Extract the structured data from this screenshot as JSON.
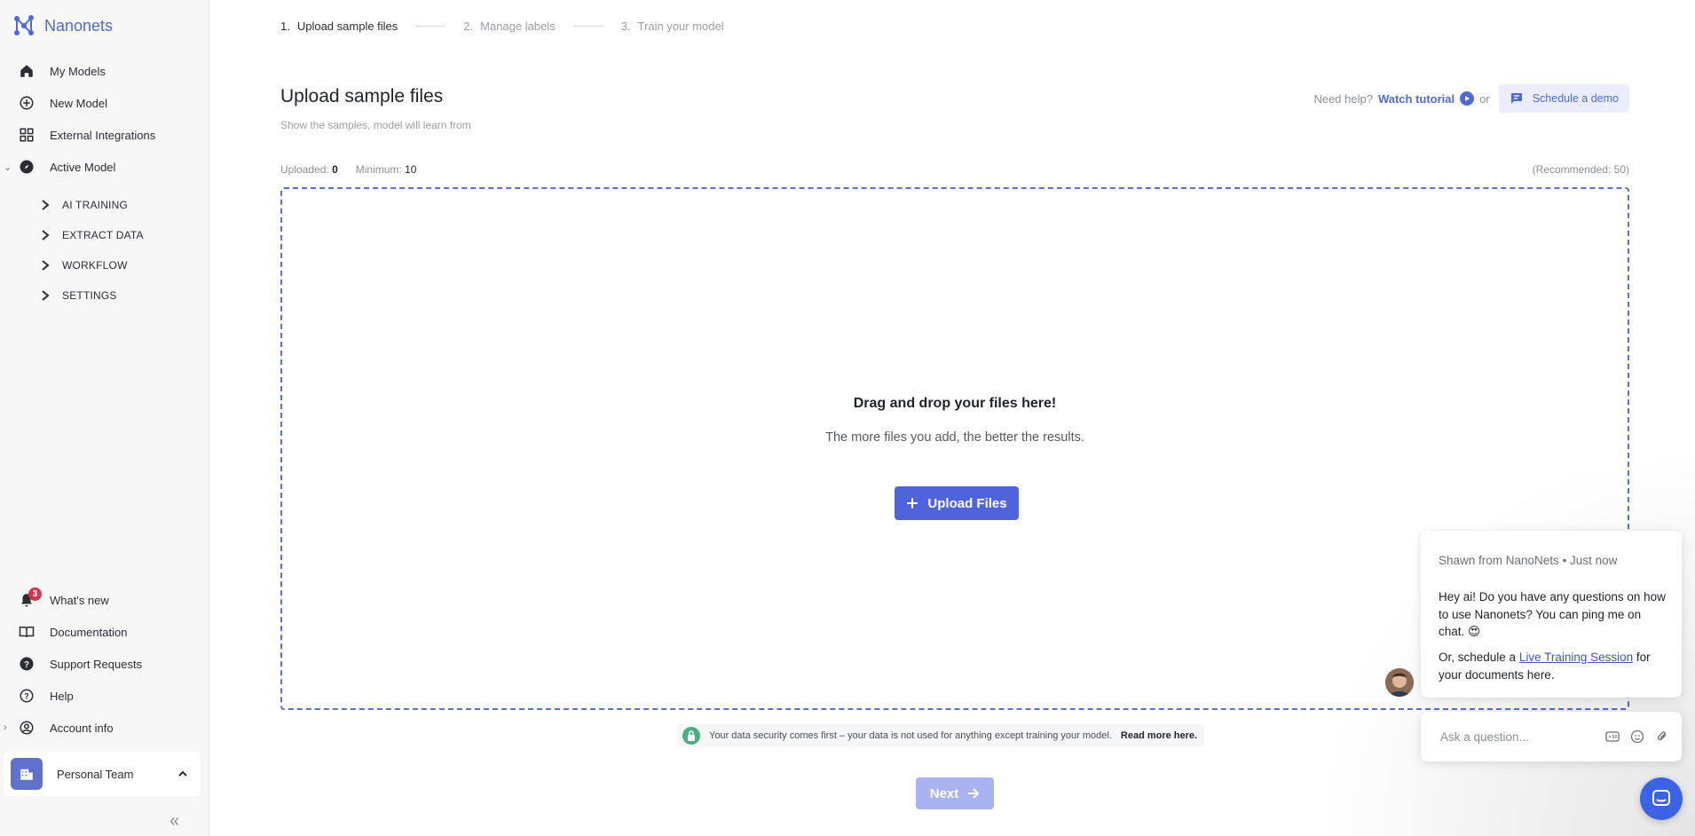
{
  "app": {
    "name": "Nanonets"
  },
  "sidebar": {
    "nav": [
      {
        "label": "My Models",
        "icon": "home-icon"
      },
      {
        "label": "New Model",
        "icon": "plus-circle-icon"
      },
      {
        "label": "External Integrations",
        "icon": "grid-icon"
      },
      {
        "label": "Active Model",
        "icon": "compass-icon"
      }
    ],
    "sub": [
      {
        "label": "AI TRAINING"
      },
      {
        "label": "EXTRACT DATA"
      },
      {
        "label": "WORKFLOW"
      },
      {
        "label": "SETTINGS"
      }
    ],
    "bottom": [
      {
        "label": "What's new",
        "icon": "bell-icon",
        "badge": "3"
      },
      {
        "label": "Documentation",
        "icon": "book-icon"
      },
      {
        "label": "Support Requests",
        "icon": "question-shield-icon"
      },
      {
        "label": "Help",
        "icon": "help-circle-icon"
      },
      {
        "label": "Account info",
        "icon": "user-circle-icon"
      }
    ],
    "team": "Personal Team",
    "collapse_glyph": "«"
  },
  "stepper": [
    {
      "num": "1.",
      "label": "Upload sample files"
    },
    {
      "num": "2.",
      "label": "Manage labels"
    },
    {
      "num": "3.",
      "label": "Train your model"
    }
  ],
  "header": {
    "title": "Upload sample files",
    "subtitle": "Show the samples, model will learn from",
    "need_help": "Need help?",
    "watch_tutorial": "Watch tutorial",
    "or": "or",
    "schedule_demo": "Schedule a demo"
  },
  "counts": {
    "uploaded_label": "Uploaded:",
    "uploaded_value": "0",
    "minimum_label": "Minimum:",
    "minimum_value": "10",
    "recommended": "(Recommended: 50)"
  },
  "dropzone": {
    "title": "Drag and drop your files here!",
    "subtitle": "The more files you add, the better the results.",
    "button": "Upload Files"
  },
  "security": {
    "text": "Your data security comes first – your data is not used for anything except training your model.",
    "link": "Read more here."
  },
  "next_button": "Next",
  "chat": {
    "from": "Shawn from NanoNets",
    "time": "• Just now",
    "message": "Hey ai! Do you have any questions on how to use Nanonets? You can ping me on chat. 😍",
    "message2_prefix": "Or, schedule a ",
    "message2_link": "Live Training Session",
    "message2_suffix": " for your documents here.",
    "input_placeholder": "Ask a question..."
  }
}
